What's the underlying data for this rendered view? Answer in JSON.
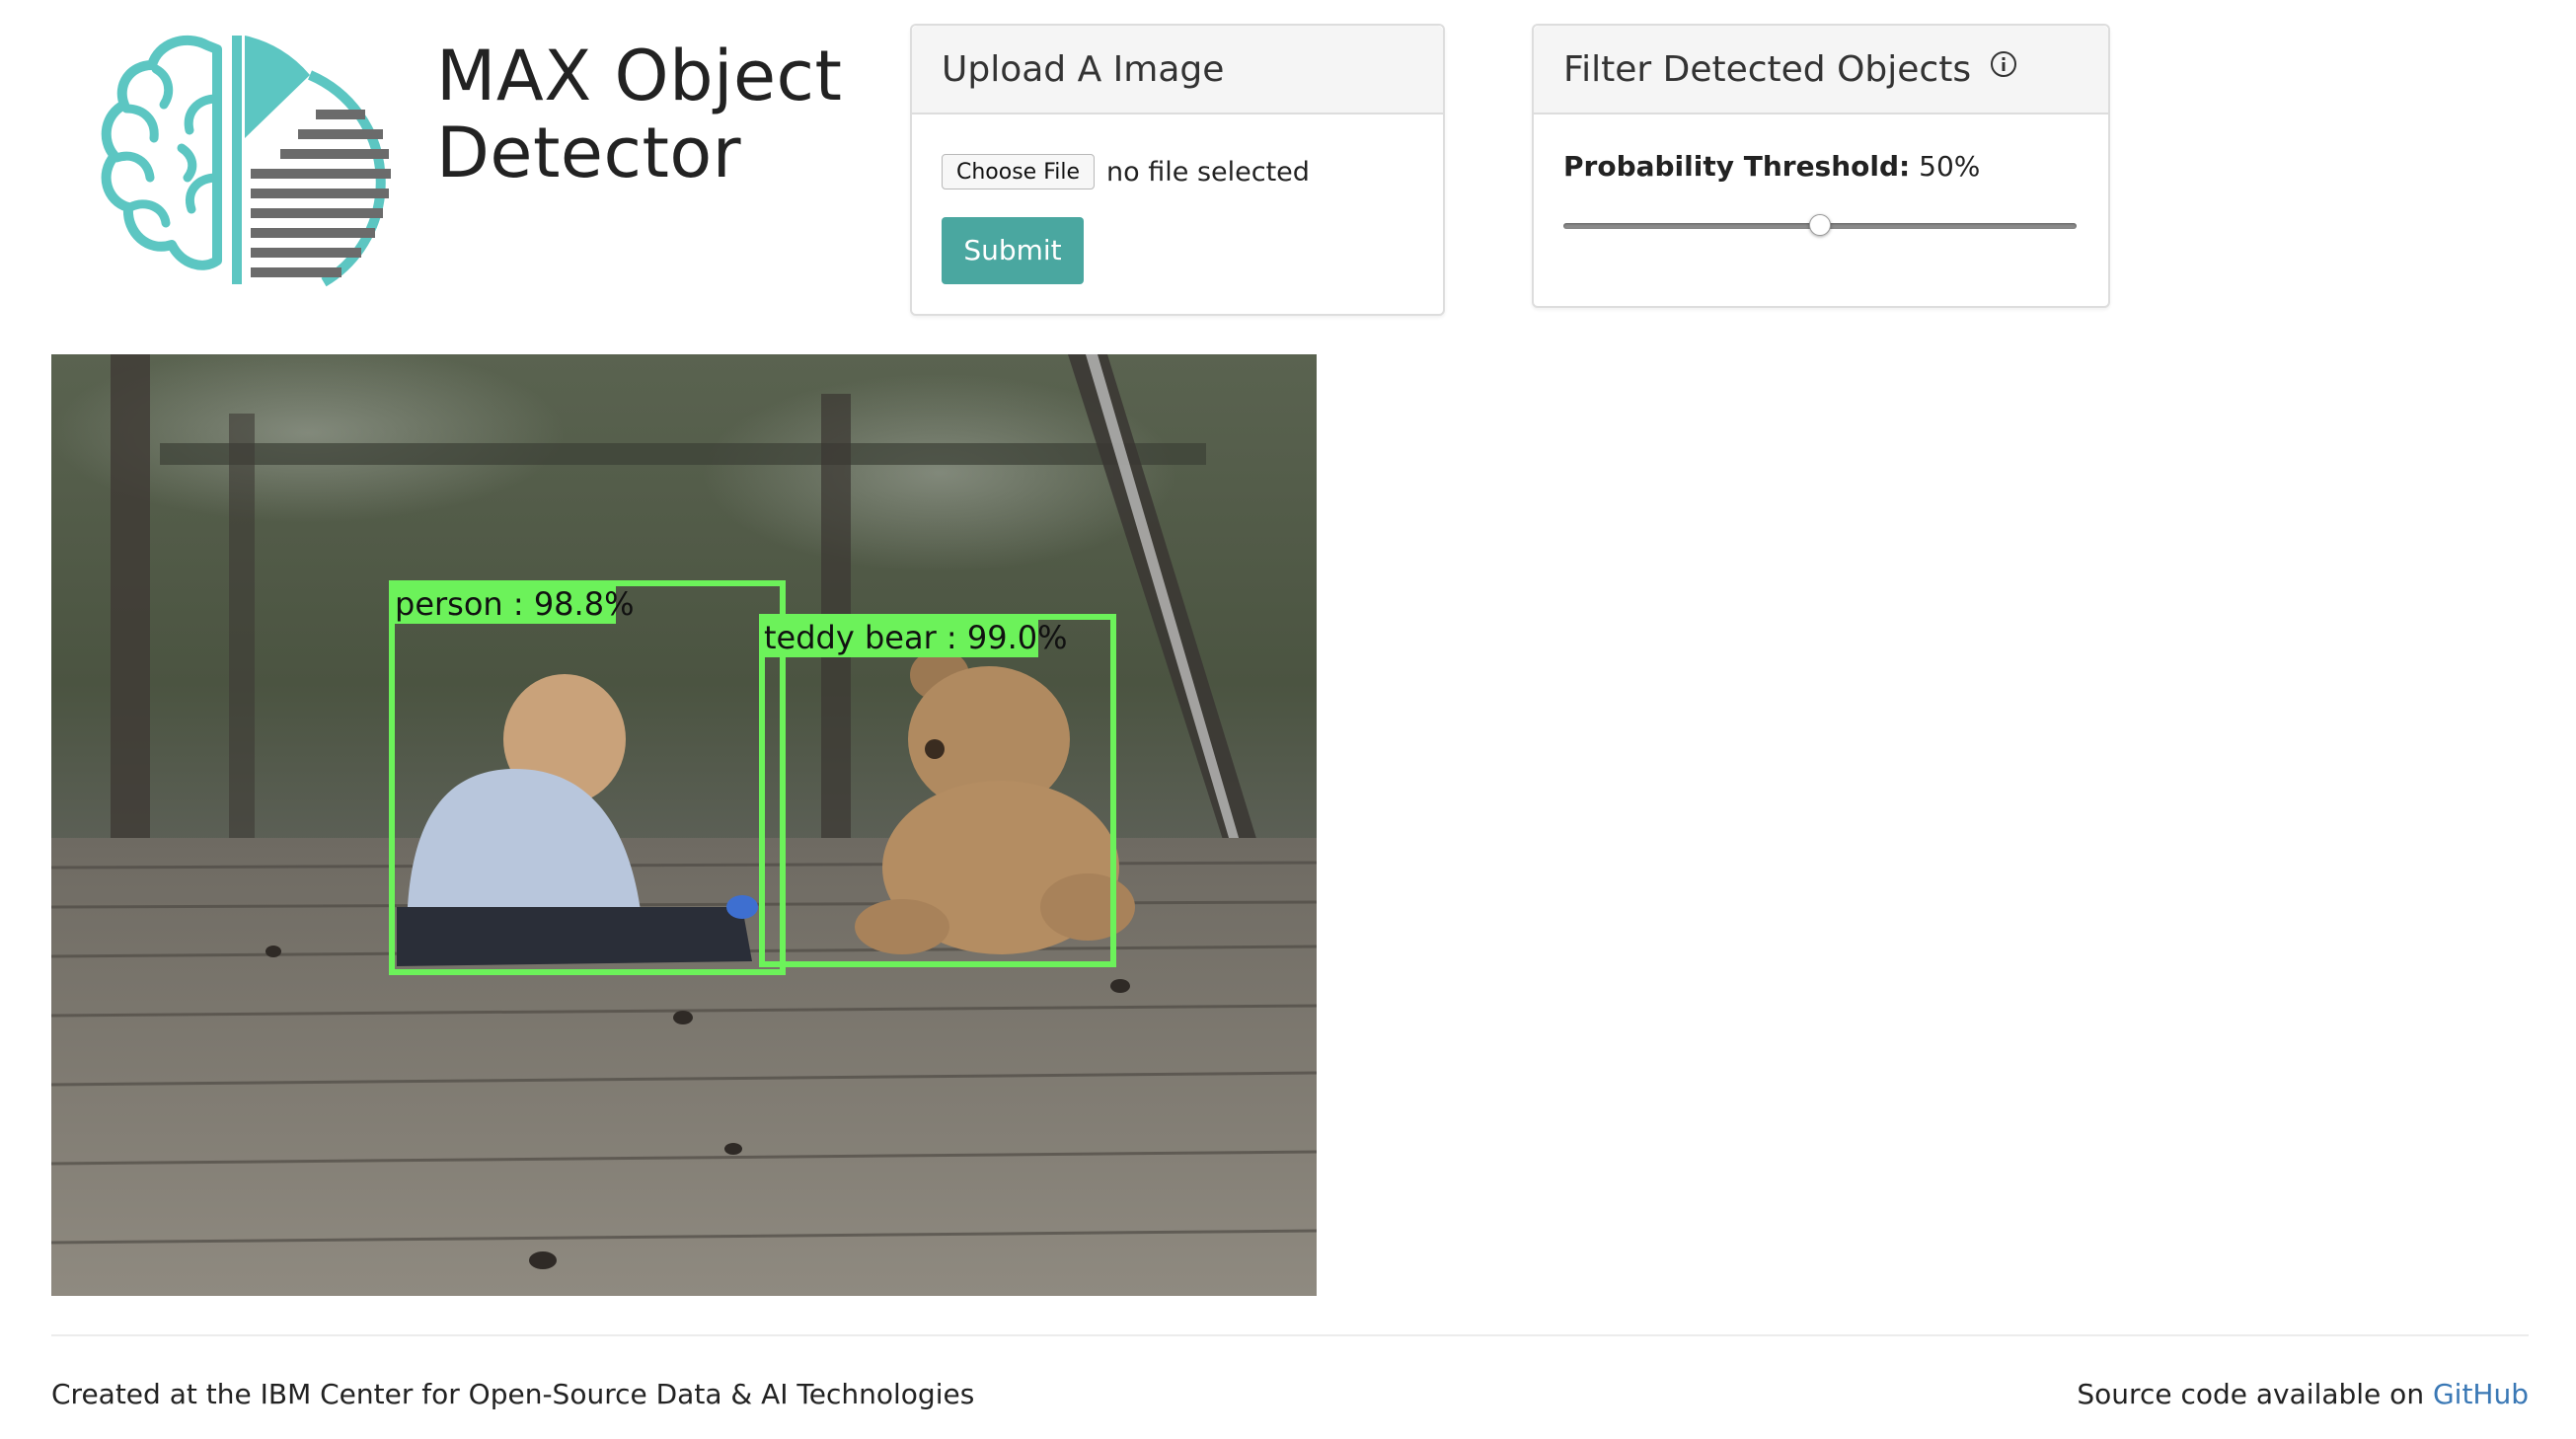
{
  "header": {
    "title_line1": "MAX Object",
    "title_line2": "Detector"
  },
  "upload": {
    "heading": "Upload A Image",
    "choose_file_label": "Choose File",
    "file_status": "no file selected",
    "submit_label": "Submit"
  },
  "filter": {
    "heading": "Filter Detected Objects",
    "info_icon": "info-icon",
    "threshold_label": "Probability Threshold:",
    "threshold_value": "50%",
    "threshold_fraction": 0.5
  },
  "result": {
    "detections": [
      {
        "label": "person : 98.8%"
      },
      {
        "label": "teddy bear : 99.0%"
      }
    ]
  },
  "footer": {
    "credit": "Created at the IBM Center for Open-Source Data & AI Technologies",
    "source_prefix": "Source code available on",
    "source_link": "GitHub"
  },
  "colors": {
    "accent": "#4aa7a0",
    "logo_teal": "#5cc6c2",
    "logo_gray": "#6b6b6b",
    "detection_box": "#6cf25a",
    "link": "#3a78b5"
  }
}
